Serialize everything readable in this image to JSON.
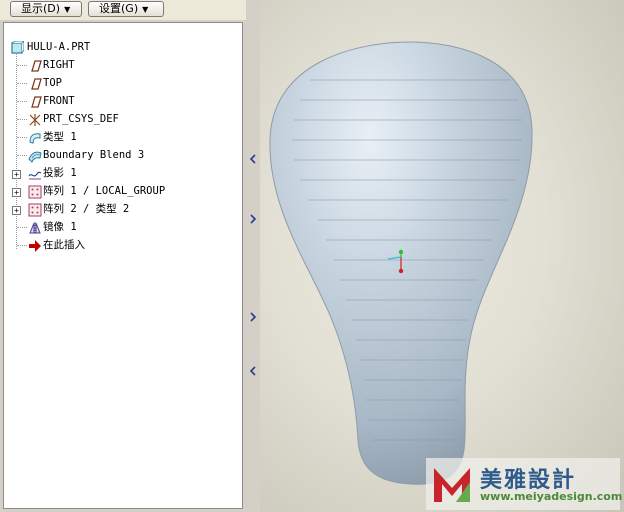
{
  "toolbar": {
    "display_label": "显示(D)",
    "settings_label": "设置(G)"
  },
  "tree": {
    "root": "HULU-A.PRT",
    "items": [
      {
        "label": "RIGHT",
        "icon": "datum-plane-icon",
        "expandable": false
      },
      {
        "label": "TOP",
        "icon": "datum-plane-icon",
        "expandable": false
      },
      {
        "label": "FRONT",
        "icon": "datum-plane-icon",
        "expandable": false
      },
      {
        "label": "PRT_CSYS_DEF",
        "icon": "coordinate-system-icon",
        "expandable": false
      },
      {
        "label": "类型 1",
        "icon": "surface-feature-icon",
        "expandable": false
      },
      {
        "label": "Boundary Blend 3",
        "icon": "boundary-blend-icon",
        "expandable": false
      },
      {
        "label": "投影 1",
        "icon": "projected-curve-icon",
        "expandable": true
      },
      {
        "label": "阵列 1 / LOCAL_GROUP",
        "icon": "pattern-icon",
        "expandable": true
      },
      {
        "label": "阵列 2 / 类型 2",
        "icon": "pattern-icon",
        "expandable": true
      },
      {
        "label": "镜像 1",
        "icon": "mirror-icon",
        "expandable": false
      },
      {
        "label": "在此插入",
        "icon": "insert-here-arrow-icon",
        "expandable": false
      }
    ]
  },
  "watermark": {
    "title": "美雅設計",
    "url": "www.meiyadesign.com"
  },
  "colors": {
    "panel": "#d4d0c8",
    "tree_bg": "#ffffff",
    "model_surface": "#c5d2dd",
    "csys_green": "#2fbf2f",
    "csys_red": "#d02020",
    "csys_cyan": "#30c0d0",
    "insert_arrow": "#c00000"
  }
}
